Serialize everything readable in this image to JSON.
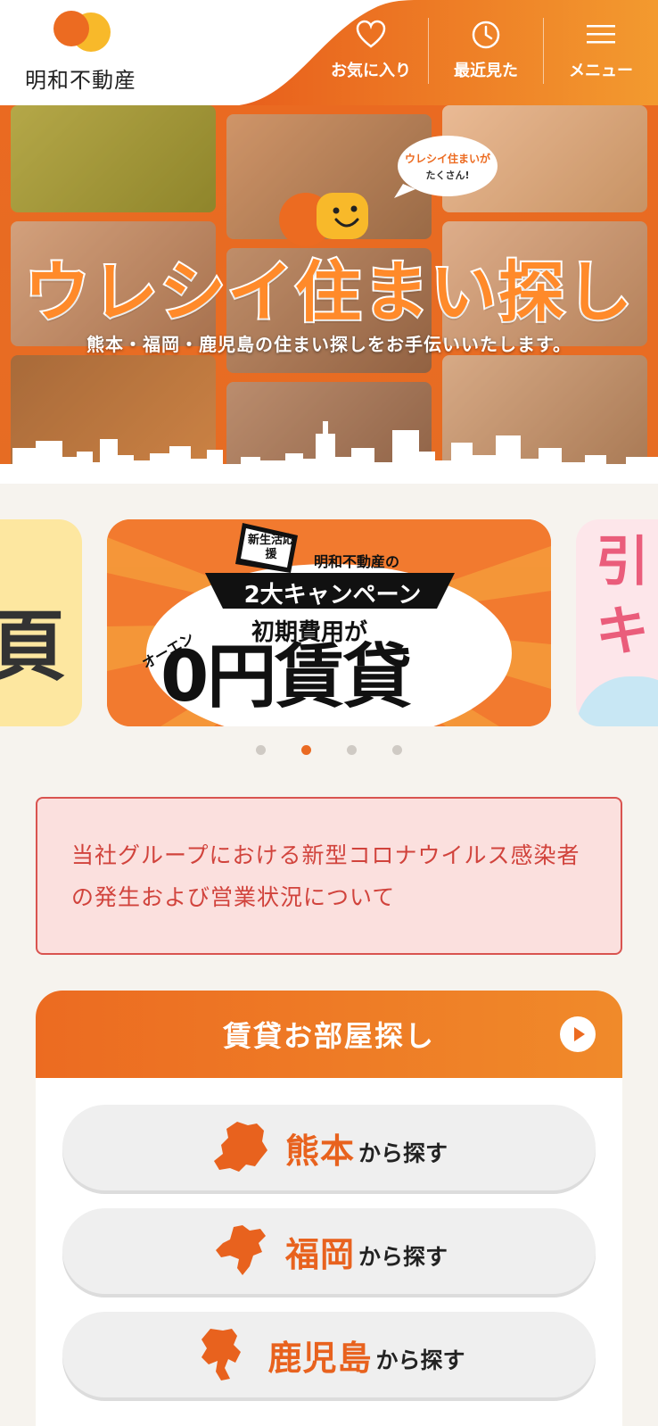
{
  "header": {
    "logo_text": "明和不動産",
    "nav": [
      {
        "label": "お気に入り",
        "icon": "heart-icon"
      },
      {
        "label": "最近見た",
        "icon": "clock-icon"
      },
      {
        "label": "メニュー",
        "icon": "menu-icon"
      }
    ]
  },
  "hero": {
    "title": "ウレシイ住まい探し",
    "subtitle": "熊本・福岡・鹿児島の住まい探しをお手伝いいたします。",
    "bubble_line1": "ウレシイ住まいが",
    "bubble_line2": "たくさん!"
  },
  "carousel": {
    "main_slide": {
      "badge": "新生活応援",
      "brand": "明和不動産の",
      "headline": "2大キャンペーン",
      "line1": "初期費用が",
      "accent": "オーエン",
      "big": "0円賃貸"
    },
    "left_slide_text": "頁",
    "right_slide_text": [
      "引",
      "キ"
    ],
    "dots": 4,
    "active_dot": 1
  },
  "notice": {
    "text": "当社グループにおける新型コロナウイルス感染者の発生および営業状況について"
  },
  "search": {
    "title": "賃貸お部屋探し",
    "buttons": [
      {
        "name": "熊本",
        "suffix": "から探す"
      },
      {
        "name": "福岡",
        "suffix": "から探す"
      },
      {
        "name": "鹿児島",
        "suffix": "から探す"
      }
    ]
  },
  "colors": {
    "brand_orange": "#ec6b21",
    "logo_yellow": "#f8b92a",
    "notice_red": "#d1433c",
    "notice_bg": "#fbe0de"
  }
}
